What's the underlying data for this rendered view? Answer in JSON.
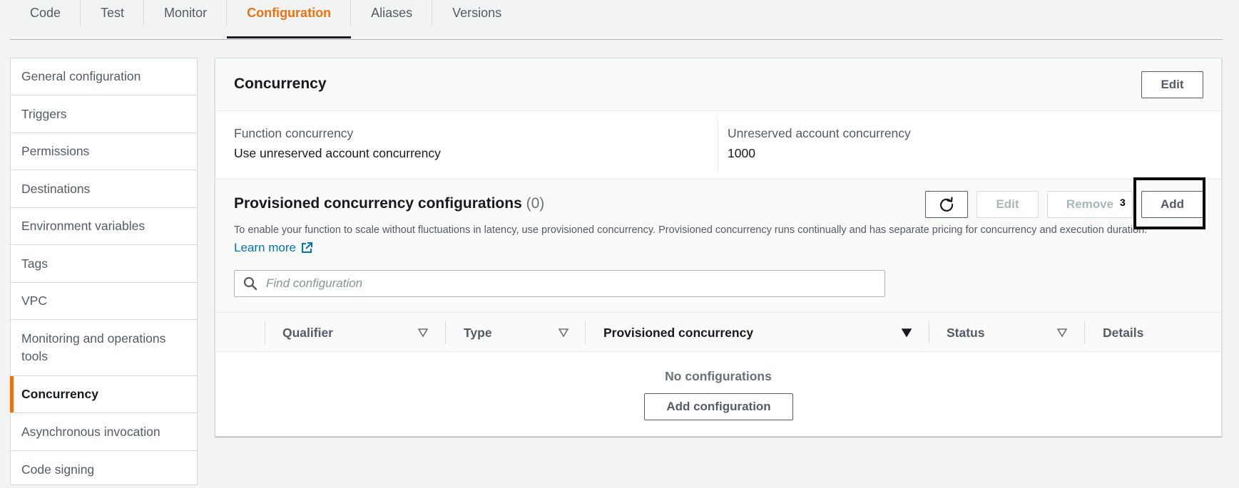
{
  "tabs": [
    {
      "label": "Code"
    },
    {
      "label": "Test"
    },
    {
      "label": "Monitor"
    },
    {
      "label": "Configuration",
      "active": true
    },
    {
      "label": "Aliases"
    },
    {
      "label": "Versions"
    }
  ],
  "sidebar": {
    "items": [
      {
        "label": "General configuration"
      },
      {
        "label": "Triggers"
      },
      {
        "label": "Permissions"
      },
      {
        "label": "Destinations"
      },
      {
        "label": "Environment variables"
      },
      {
        "label": "Tags"
      },
      {
        "label": "VPC"
      },
      {
        "label": "Monitoring and operations tools"
      },
      {
        "label": "Concurrency",
        "active": true
      },
      {
        "label": "Asynchronous invocation"
      },
      {
        "label": "Code signing"
      }
    ]
  },
  "concurrency": {
    "title": "Concurrency",
    "edit_label": "Edit",
    "function_concurrency_label": "Function concurrency",
    "function_concurrency_value": "Use unreserved account concurrency",
    "unreserved_label": "Unreserved account concurrency",
    "unreserved_value": "1000"
  },
  "provisioned": {
    "title": "Provisioned concurrency configurations",
    "count": "(0)",
    "edit_label": "Edit",
    "remove_label": "Remove",
    "add_label": "Add",
    "description": "To enable your function to scale without fluctuations in latency, use provisioned concurrency. Provisioned concurrency runs continually and has separate pricing for concurrency and execution duration.",
    "learn_more": "Learn more",
    "search_placeholder": "Find configuration",
    "columns": [
      "Qualifier",
      "Type",
      "Provisioned concurrency",
      "Status",
      "Details"
    ],
    "empty_text": "No configurations",
    "add_config_label": "Add configuration"
  },
  "annotation": {
    "badge": "3"
  },
  "colors": {
    "accent": "#ec7211",
    "link": "#0073bb"
  }
}
